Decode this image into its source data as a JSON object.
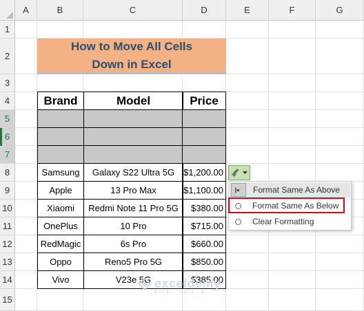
{
  "sheet": {
    "columns": [
      "A",
      "B",
      "C",
      "D",
      "E",
      "F",
      "G"
    ],
    "rows": [
      "1",
      "2",
      "3",
      "4",
      "5",
      "6",
      "7",
      "8",
      "9",
      "10",
      "11",
      "12",
      "13",
      "14",
      "15"
    ]
  },
  "title": {
    "line1": "How to Move All Cells",
    "line2": "Down in Excel"
  },
  "table": {
    "headers": {
      "brand": "Brand",
      "model": "Model",
      "price": "Price"
    },
    "rows": [
      {
        "brand": "Samsung",
        "model": "Galaxy S22 Ultra 5G",
        "price": "$1,200.00"
      },
      {
        "brand": "Apple",
        "model": "13 Pro Max",
        "price": "$1,100.00"
      },
      {
        "brand": "Xiaomi",
        "model": "Redmi Note 11 Pro 5G",
        "price": "$380.00"
      },
      {
        "brand": "OnePlus",
        "model": "10 Pro",
        "price": "$715.00"
      },
      {
        "brand": "RedMagic",
        "model": "6s Pro",
        "price": "$660.00"
      },
      {
        "brand": "Oppo",
        "model": "Reno5 Pro 5G",
        "price": "$850.00"
      },
      {
        "brand": "Vivo",
        "model": "V23e 5G",
        "price": "$385.00"
      }
    ]
  },
  "insert_options": {
    "items": [
      "Format Same As Above",
      "Format Same As Below",
      "Clear Formatting"
    ],
    "selected_index": 0,
    "highlighted_index": 1,
    "highlight_color": "#d9001b"
  },
  "watermark": {
    "name": "exceldemy",
    "tagline": "EXCEL · DATA · BI"
  },
  "colors": {
    "title_bg": "#f4b183",
    "title_text": "#2f4e6f",
    "gray_fill": "#c8c8c8",
    "selection_green": "#217346"
  }
}
